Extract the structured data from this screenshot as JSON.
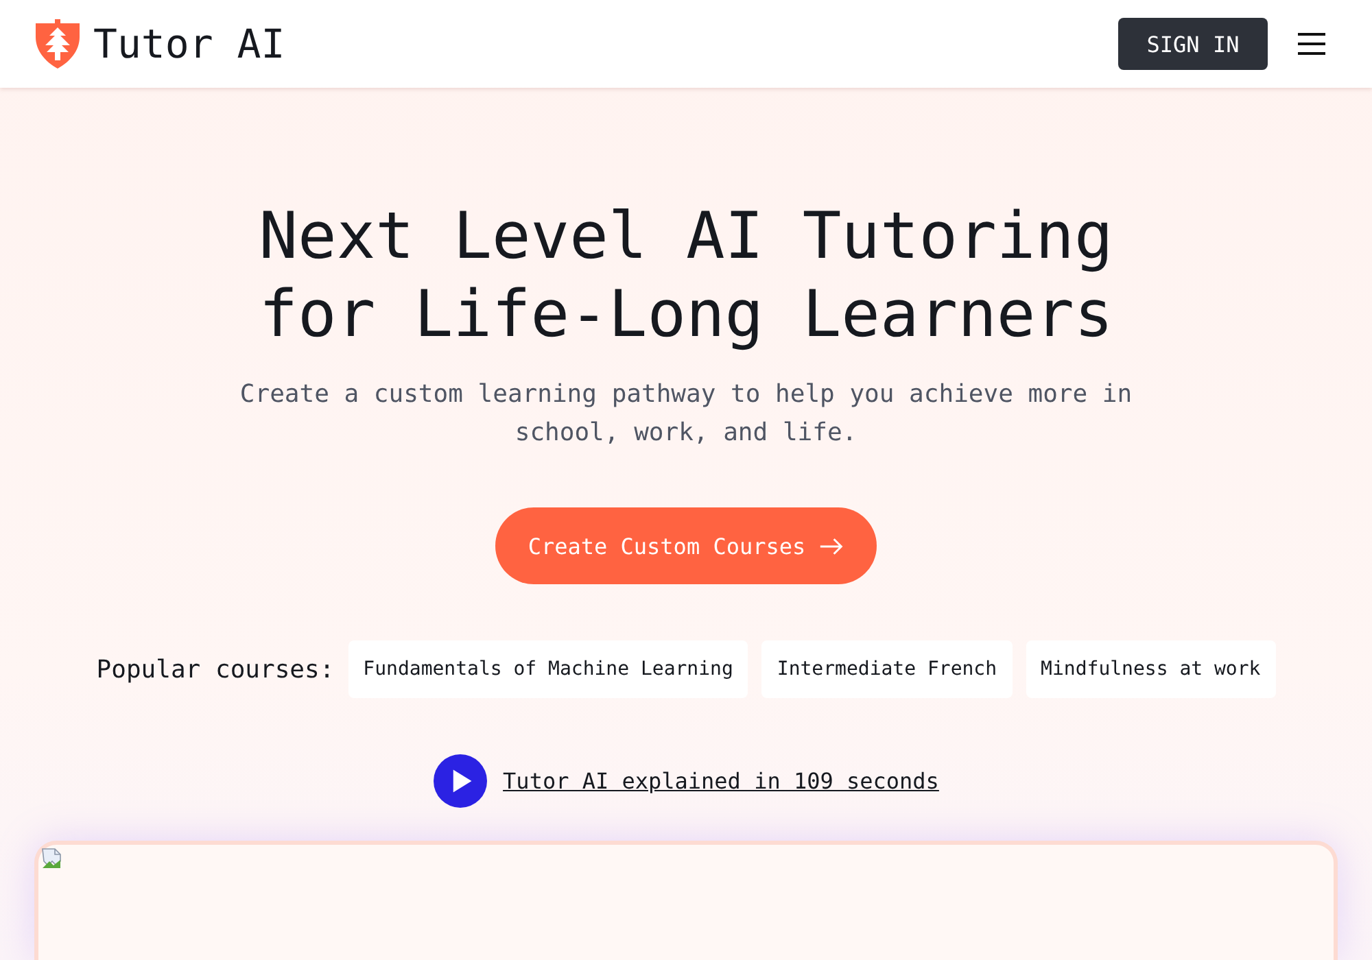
{
  "header": {
    "logo_text": "Tutor AI",
    "sign_in": "SIGN IN"
  },
  "hero": {
    "title": "Next Level AI Tutoring for Life-Long Learners",
    "subtitle": "Create a custom learning pathway to help you achieve more in school, work, and life.",
    "cta": "Create Custom Courses"
  },
  "popular": {
    "label": "Popular courses:",
    "courses": [
      "Fundamentals of Machine Learning",
      "Intermediate French",
      "Mindfulness at work"
    ]
  },
  "video_link": {
    "text": "Tutor AI explained in 109 seconds"
  }
}
